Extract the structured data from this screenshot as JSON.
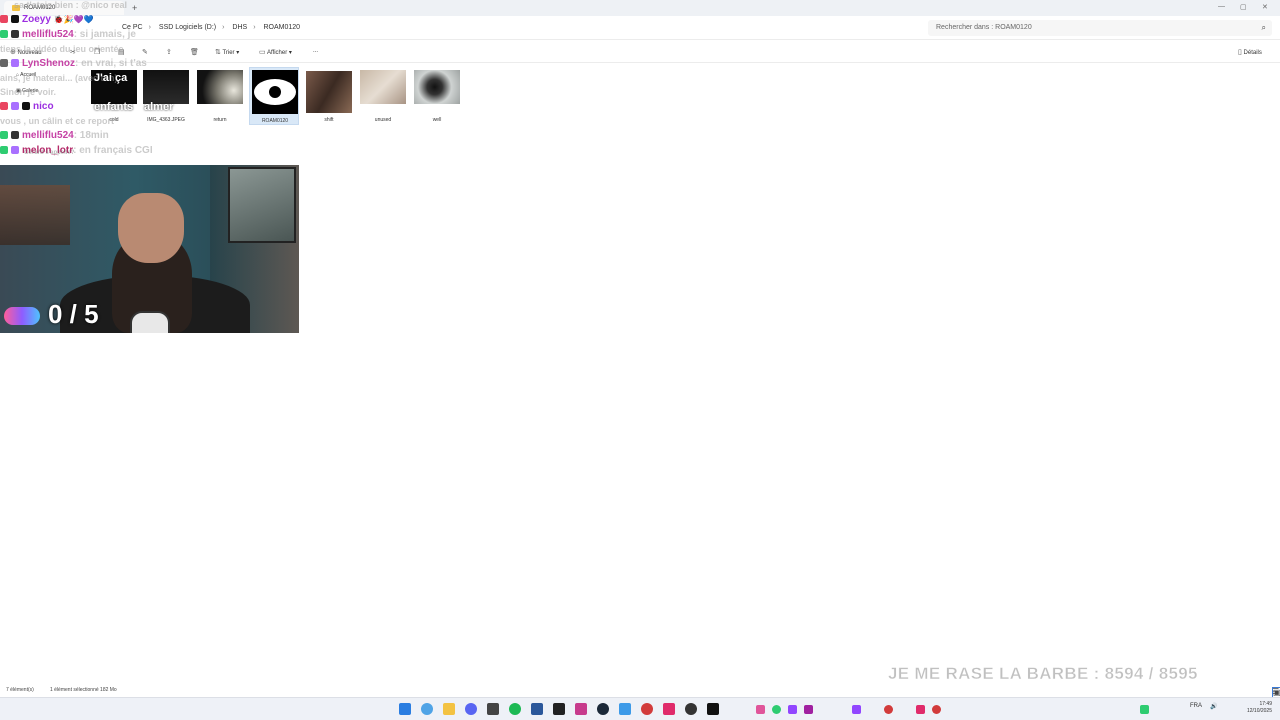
{
  "window": {
    "tab_title": "ROAM0120",
    "add_tab": "+",
    "controls": [
      "—",
      "▢",
      "✕"
    ]
  },
  "breadcrumbs": [
    "Ce PC",
    "SSD Logiciels (D:)",
    "DHS",
    "ROAM0120"
  ],
  "search": {
    "placeholder": "Rechercher dans : ROAM0120"
  },
  "command_bar": {
    "new_label": "Nouveau",
    "sort_label": "Trier",
    "view_label": "Afficher",
    "more_label": "...",
    "details_label": "Détails"
  },
  "sidebar": {
    "items": [
      "Accueil",
      "Galerie"
    ]
  },
  "files": [
    {
      "name": "cold"
    },
    {
      "name": "IMG_4363.JPEG"
    },
    {
      "name": "return"
    },
    {
      "name": "ROAM0120"
    },
    {
      "name": "shift"
    },
    {
      "name": "unused"
    },
    {
      "name": "well"
    }
  ],
  "chat": [
    {
      "user": "Zoeyy",
      "color": "#9b2ee0",
      "message": "",
      "suffix": "🐞🎉💜💙"
    },
    {
      "user": "melliflu524",
      "color": "#c542a5",
      "message": ": si jamais, je"
    },
    {
      "user": "LynShenoz",
      "color": "#c542a5",
      "message": ": en vrai, si t'as"
    },
    {
      "user": "nico",
      "color": "#9b2ee0",
      "message": ""
    },
    {
      "user": "melliflu524",
      "color": "#c542a5",
      "message": ": 18min"
    },
    {
      "user": "melon_lotr",
      "color": "#b52a6a",
      "message": ": en français CGI"
    }
  ],
  "chat_faint": [
    "sa t'etais bien : @nico real",
    "tiens la vidéo du jeu orientée",
    "ains, je materai... (avec ton)",
    "Sinon je voir.",
    "vous , un câlin et ce report",
    "Gérard s'appelle?"
  ],
  "captions": [
    "J'ai ça",
    "enfants",
    "almer"
  ],
  "webcam": {
    "counter": "0 / 5"
  },
  "status": {
    "count": "7 élément(s)",
    "selection": "1 élément sélectionné  182 Mo"
  },
  "overlay_goal": "JE ME RASE LA BARBE : 8594 / 8595",
  "tray": {
    "lang": "FRA",
    "time": "17:49",
    "date": "12/10/2025"
  }
}
